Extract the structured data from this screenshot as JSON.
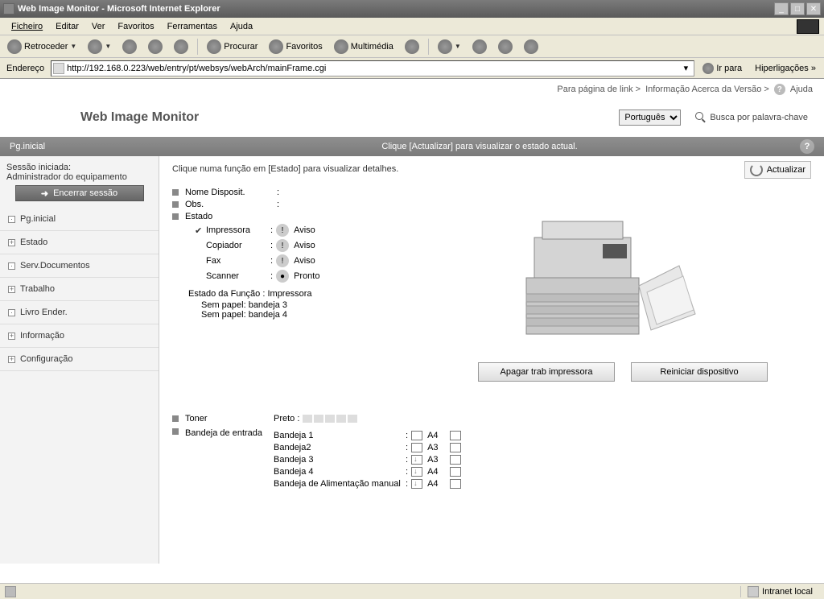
{
  "window": {
    "title": "Web Image Monitor - Microsoft Internet Explorer"
  },
  "menu": {
    "items": [
      "Ficheiro",
      "Editar",
      "Ver",
      "Favoritos",
      "Ferramentas",
      "Ajuda"
    ]
  },
  "toolbar": {
    "back": "Retroceder",
    "search": "Procurar",
    "favorites": "Favoritos",
    "media": "Multimédia"
  },
  "address": {
    "label": "Endereço",
    "value": "http://192.168.0.223/web/entry/pt/websys/webArch/mainFrame.cgi",
    "go": "Ir para",
    "links": "Hiperligações"
  },
  "toplinks": {
    "link_page": "Para página de link >",
    "version_info": "Informação Acerca da Versão >",
    "help": "Ajuda"
  },
  "header": {
    "title": "Web Image Monitor",
    "language": "Português",
    "search_label": "Busca por palavra-chave"
  },
  "subheader": {
    "left": "Pg.inicial",
    "center": "Clique [Actualizar] para visualizar o estado actual."
  },
  "session": {
    "line1": "Sessão iniciada:",
    "line2": "Administrador do equipamento",
    "logout": "Encerrar sessão"
  },
  "nav": {
    "items": [
      {
        "label": "Pg.inicial",
        "expand": "·"
      },
      {
        "label": "Estado",
        "expand": "+"
      },
      {
        "label": "Serv.Documentos",
        "expand": "·"
      },
      {
        "label": "Trabalho",
        "expand": "+"
      },
      {
        "label": "Livro Ender.",
        "expand": "·"
      },
      {
        "label": "Informação",
        "expand": "+"
      },
      {
        "label": "Configuração",
        "expand": "+"
      }
    ]
  },
  "panel": {
    "hint": "Clique numa função em [Estado] para visualizar detalhes.",
    "refresh": "Actualizar",
    "device_name_label": "Nome Disposit.",
    "obs_label": "Obs.",
    "state_label": "Estado",
    "functions": [
      {
        "name": "Impressora",
        "status": "Aviso",
        "checked": true
      },
      {
        "name": "Copiador",
        "status": "Aviso",
        "checked": false
      },
      {
        "name": "Fax",
        "status": "Aviso",
        "checked": false
      },
      {
        "name": "Scanner",
        "status": "Pronto",
        "checked": false
      }
    ],
    "func_state_label": "Estado da Função",
    "func_state_value": "Impressora",
    "messages": [
      "Sem papel: bandeja 3",
      "Sem papel: bandeja 4"
    ],
    "actions": {
      "clear_jobs": "Apagar trab impressora",
      "restart": "Reiniciar dispositivo"
    },
    "toner_label": "Toner",
    "toner_color": "Preto :",
    "tray_label": "Bandeja de entrada",
    "trays": [
      {
        "name": "Bandeja 1",
        "size": "A4",
        "empty": false
      },
      {
        "name": "Bandeja2",
        "size": "A3",
        "empty": false
      },
      {
        "name": "Bandeja 3",
        "size": "A3",
        "empty": true
      },
      {
        "name": "Bandeja 4",
        "size": "A4",
        "empty": true
      },
      {
        "name": "Bandeja de Alimentação manual",
        "size": "A4",
        "empty": true
      }
    ]
  },
  "statusbar": {
    "zone": "Intranet local"
  }
}
